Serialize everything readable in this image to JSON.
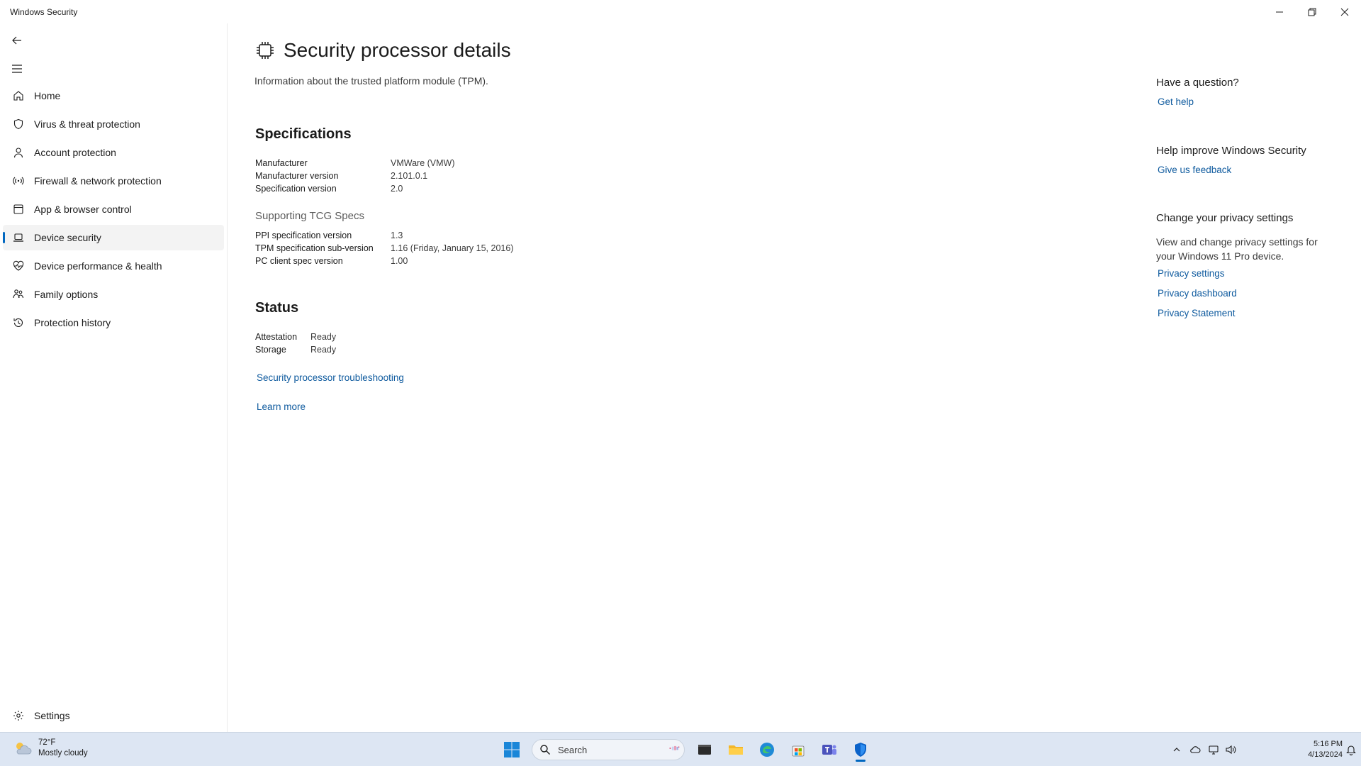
{
  "window": {
    "title": "Windows Security"
  },
  "sidebar": {
    "items": [
      {
        "label": "Home",
        "icon": "home-icon"
      },
      {
        "label": "Virus & threat protection",
        "icon": "shield-icon"
      },
      {
        "label": "Account protection",
        "icon": "person-icon"
      },
      {
        "label": "Firewall & network protection",
        "icon": "wireless-icon"
      },
      {
        "label": "App & browser control",
        "icon": "app-window-icon"
      },
      {
        "label": "Device security",
        "icon": "laptop-icon",
        "active": true
      },
      {
        "label": "Device performance & health",
        "icon": "heart-pulse-icon"
      },
      {
        "label": "Family options",
        "icon": "family-icon"
      },
      {
        "label": "Protection history",
        "icon": "history-icon"
      }
    ],
    "settings_label": "Settings"
  },
  "main": {
    "title": "Security processor details",
    "description": "Information about the trusted platform module (TPM).",
    "specifications": {
      "heading": "Specifications",
      "rows": [
        {
          "label": "Manufacturer",
          "value": "VMWare (VMW)"
        },
        {
          "label": "Manufacturer version",
          "value": "2.101.0.1"
        },
        {
          "label": "Specification version",
          "value": "2.0"
        }
      ]
    },
    "tcg": {
      "heading": "Supporting TCG Specs",
      "rows": [
        {
          "label": "PPI specification version",
          "value": "1.3"
        },
        {
          "label": "TPM specification sub-version",
          "value": "1.16 (Friday, January 15, 2016)"
        },
        {
          "label": "PC client spec version",
          "value": "1.00"
        }
      ]
    },
    "status": {
      "heading": "Status",
      "rows": [
        {
          "label": "Attestation",
          "value": "Ready"
        },
        {
          "label": "Storage",
          "value": "Ready"
        }
      ]
    },
    "troubleshooting_link": "Security processor troubleshooting",
    "learn_more_link": "Learn more"
  },
  "aside": {
    "question_heading": "Have a question?",
    "get_help": "Get help",
    "improve_heading": "Help improve Windows Security",
    "feedback": "Give us feedback",
    "privacy_heading": "Change your privacy settings",
    "privacy_text": "View and change privacy settings for your Windows 11 Pro device.",
    "privacy_settings": "Privacy settings",
    "privacy_dashboard": "Privacy dashboard",
    "privacy_statement": "Privacy Statement"
  },
  "taskbar": {
    "weather_temp": "72°F",
    "weather_desc": "Mostly cloudy",
    "search_label": "Search",
    "time": "5:16 PM",
    "date": "4/13/2024"
  },
  "colors": {
    "accent": "#0067c0",
    "link": "#0e5a9e",
    "taskbar": "#dde6f3"
  }
}
